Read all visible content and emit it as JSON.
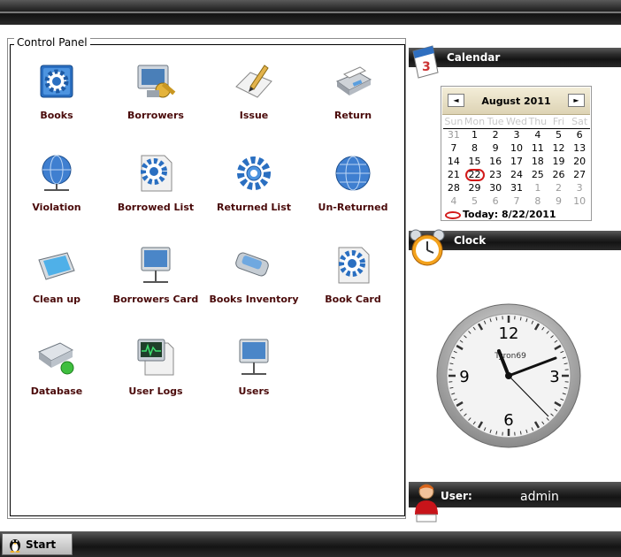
{
  "control_panel": {
    "title": "Control Panel",
    "items": [
      {
        "label": "Books",
        "icon": "gear-book-icon"
      },
      {
        "label": "Borrowers",
        "icon": "borrowers-icon"
      },
      {
        "label": "Issue",
        "icon": "issue-pencil-icon"
      },
      {
        "label": "Return",
        "icon": "return-printer-icon"
      },
      {
        "label": "Violation",
        "icon": "globe-network-icon"
      },
      {
        "label": "Borrowed List",
        "icon": "gear-document-icon"
      },
      {
        "label": "Returned List",
        "icon": "gear-icon"
      },
      {
        "label": "Un-Returned",
        "icon": "globe-icon"
      },
      {
        "label": "Clean up",
        "icon": "tablet-icon"
      },
      {
        "label": "Borrowers  Card",
        "icon": "monitor-network-icon"
      },
      {
        "label": "Books Inventory",
        "icon": "usb-drive-icon"
      },
      {
        "label": "Book Card",
        "icon": "gear-card-icon"
      },
      {
        "label": "Database",
        "icon": "database-icon"
      },
      {
        "label": "User Logs",
        "icon": "monitor-logs-icon"
      },
      {
        "label": "Users",
        "icon": "monitor-users-icon"
      }
    ]
  },
  "calendar": {
    "header": "Calendar",
    "month": "August 2011",
    "prev": "◄",
    "next": "►",
    "weekdays": [
      "Sun",
      "Mon",
      "Tue",
      "Wed",
      "Thu",
      "Fri",
      "Sat"
    ],
    "weeks": [
      [
        "31",
        "1",
        "2",
        "3",
        "4",
        "5",
        "6"
      ],
      [
        "7",
        "8",
        "9",
        "10",
        "11",
        "12",
        "13"
      ],
      [
        "14",
        "15",
        "16",
        "17",
        "18",
        "19",
        "20"
      ],
      [
        "21",
        "22",
        "23",
        "24",
        "25",
        "26",
        "27"
      ],
      [
        "28",
        "29",
        "30",
        "31",
        "1",
        "2",
        "3"
      ],
      [
        "4",
        "5",
        "6",
        "7",
        "8",
        "9",
        "10"
      ]
    ],
    "selected": "22",
    "today_text": "Today: 8/22/2011"
  },
  "clock": {
    "header": "Clock",
    "brand": "Tyron69",
    "numbers": {
      "n12": "12",
      "n3": "3",
      "n6": "6",
      "n9": "9"
    }
  },
  "user": {
    "label": "User:",
    "name": "admin"
  },
  "taskbar": {
    "start_label": "Start"
  },
  "colors": {
    "label_text": "#4a0a0a",
    "icon_blue": "#2f78c8",
    "selected_ring": "#d21a1a",
    "calendar_header": "#e8dfc2"
  }
}
